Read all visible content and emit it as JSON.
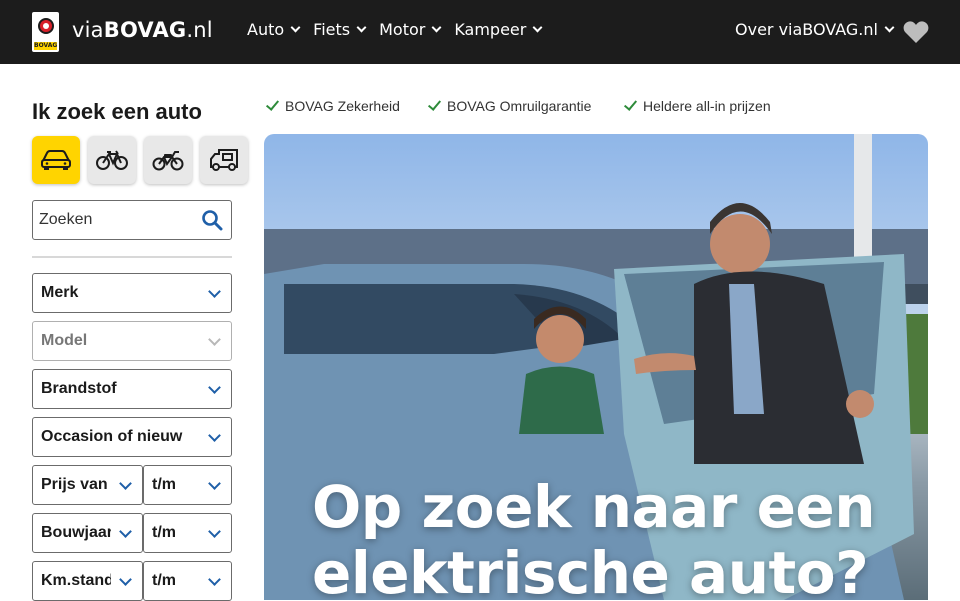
{
  "header": {
    "logo_word": "BOVAG",
    "brand_prefix": "via",
    "brand_bold": "BOVAG",
    "brand_suffix": ".nl",
    "nav": [
      {
        "label": "Auto"
      },
      {
        "label": "Fiets"
      },
      {
        "label": "Motor"
      },
      {
        "label": "Kampeer"
      }
    ],
    "about_label": "Over viaBOVAG.nl",
    "favorites_icon": "heart-icon"
  },
  "sidebar": {
    "title": "Ik zoek een auto",
    "vehicle_types": [
      {
        "icon": "car-icon",
        "active": true
      },
      {
        "icon": "bicycle-icon",
        "active": false
      },
      {
        "icon": "motorcycle-icon",
        "active": false
      },
      {
        "icon": "camper-icon",
        "active": false
      }
    ],
    "search": {
      "placeholder": "Zoeken",
      "icon": "search-icon"
    },
    "filters": {
      "merk": "Merk",
      "model": "Model",
      "brandstof": "Brandstof",
      "occasion": "Occasion of nieuw",
      "prijs_van": "Prijs van",
      "prijs_tm": "t/m",
      "bouwjaar": "Bouwjaar van",
      "bouwjaar_tm": "t/m",
      "kmstand": "Km.stand van",
      "kmstand_tm": "t/m"
    }
  },
  "usps": [
    {
      "label": "BOVAG Zekerheid"
    },
    {
      "label": "BOVAG Omruilgarantie"
    },
    {
      "label": "Heldere all-in prijzen"
    }
  ],
  "hero": {
    "line1": "Op zoek naar een",
    "line2": "elektrische auto?"
  },
  "colors": {
    "topbar": "#1c1c1c",
    "brand_yellow": "#ffd400",
    "link_blue": "#1f5fa8",
    "check_green": "#2e8b3a"
  }
}
